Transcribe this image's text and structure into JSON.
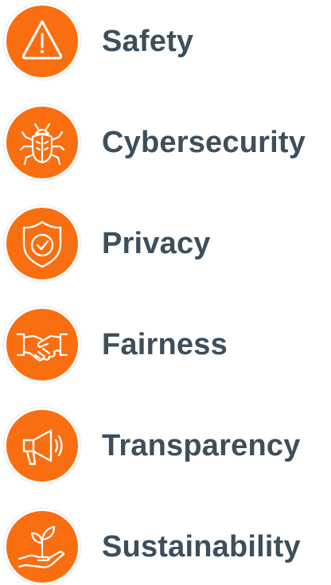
{
  "colors": {
    "accent": "#F96E10",
    "text": "#3D4E5C",
    "icon_stroke": "#FFFFFF"
  },
  "items": [
    {
      "label": "Safety",
      "icon": "warning-triangle-icon"
    },
    {
      "label": "Cybersecurity",
      "icon": "bug-icon"
    },
    {
      "label": "Privacy",
      "icon": "shield-check-icon"
    },
    {
      "label": "Fairness",
      "icon": "handshake-icon"
    },
    {
      "label": "Transparency",
      "icon": "megaphone-icon"
    },
    {
      "label": "Sustainability",
      "icon": "hand-plant-icon"
    }
  ]
}
